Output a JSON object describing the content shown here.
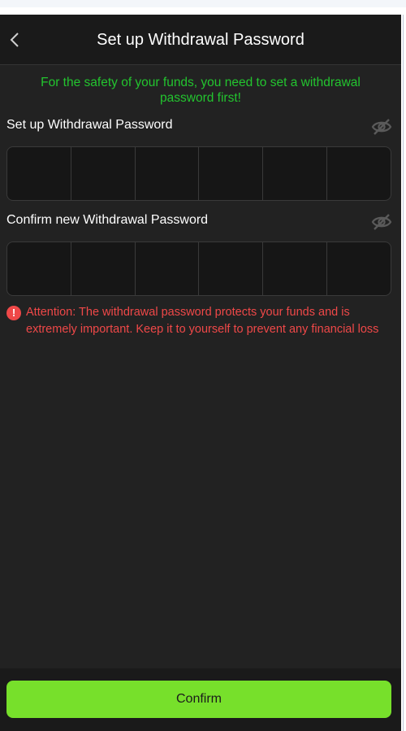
{
  "header": {
    "title": "Set up Withdrawal Password",
    "back_icon": "chevron-left-icon"
  },
  "notice": "For the safety of your funds, you need to set a withdrawal password first!",
  "password_field": {
    "label": "Set up Withdrawal Password",
    "toggle_icon": "eye-off-icon",
    "cells": [
      "",
      "",
      "",
      "",
      "",
      ""
    ]
  },
  "confirm_field": {
    "label": "Confirm new Withdrawal Password",
    "toggle_icon": "eye-off-icon",
    "cells": [
      "",
      "",
      "",
      "",
      "",
      ""
    ]
  },
  "attention": {
    "icon": "exclamation-circle-icon",
    "text": "Attention: The withdrawal password protects your funds and is extremely important. Keep it to yourself to prevent any financial loss"
  },
  "footer": {
    "confirm_label": "Confirm"
  },
  "colors": {
    "notice_green": "#23c42f",
    "warning_red": "#ef4848",
    "confirm_green": "#77e02b",
    "background": "#222222"
  }
}
